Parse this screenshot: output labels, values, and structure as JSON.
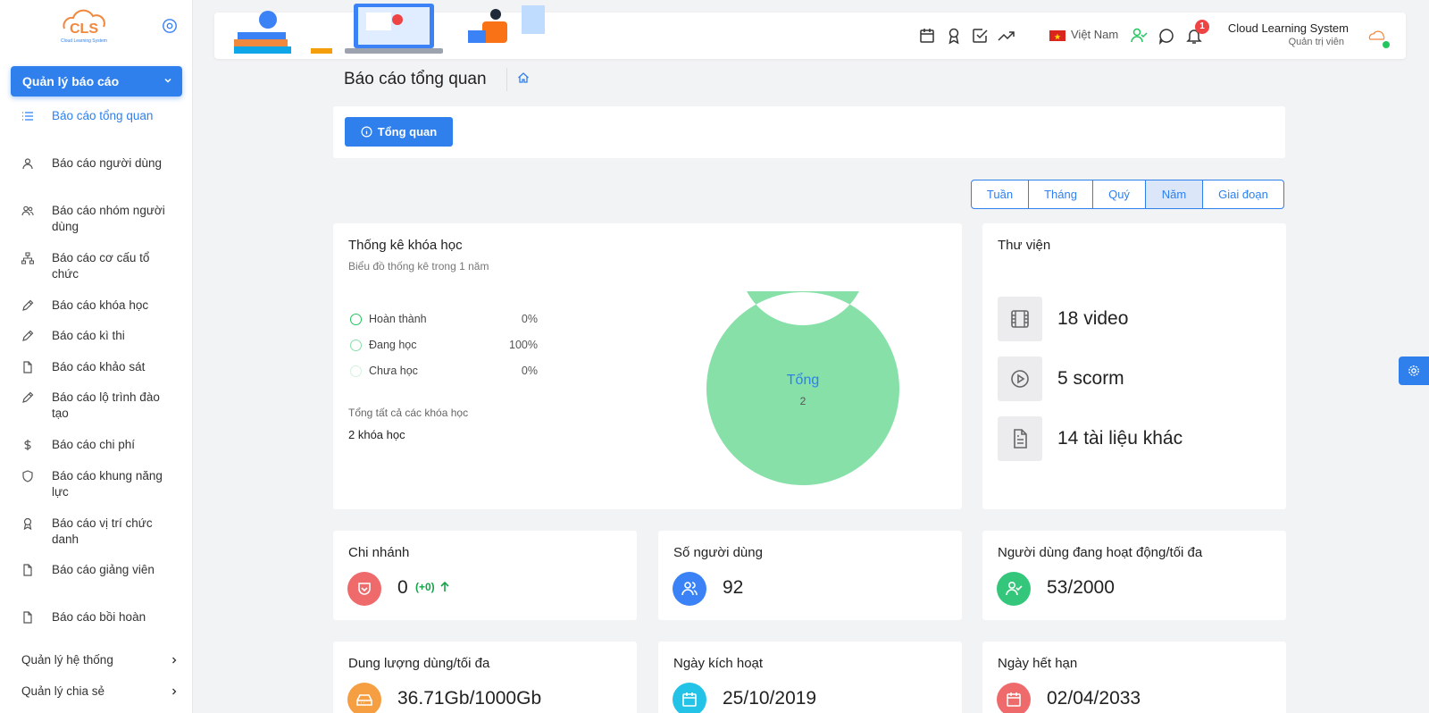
{
  "logo": {
    "text": "CLS",
    "caption": "Cloud Learning System"
  },
  "sidebar": {
    "active_group": "Quản lý báo cáo",
    "items": [
      {
        "label": "Báo cáo tổng quan",
        "icon": "list-icon"
      },
      {
        "label": "Báo cáo người dùng",
        "icon": "user-icon"
      },
      {
        "label": "Báo cáo nhóm người dùng",
        "icon": "users-icon"
      },
      {
        "label": "Báo cáo cơ cấu tổ chức",
        "icon": "sitemap-icon"
      },
      {
        "label": "Báo cáo khóa học",
        "icon": "pencil-icon"
      },
      {
        "label": "Báo cáo kì thi",
        "icon": "pencil-icon"
      },
      {
        "label": "Báo cáo khảo sát",
        "icon": "file-icon"
      },
      {
        "label": "Báo cáo lộ trình đào tạo",
        "icon": "pencil-icon"
      },
      {
        "label": "Báo cáo chi phí",
        "icon": "dollar-icon"
      },
      {
        "label": "Báo cáo khung năng lực",
        "icon": "shield-icon"
      },
      {
        "label": "Báo cáo vị trí chức danh",
        "icon": "award-icon"
      },
      {
        "label": "Báo cáo giảng viên",
        "icon": "file-icon"
      },
      {
        "label": "Báo cáo bồi hoàn",
        "icon": "file-icon"
      }
    ],
    "groups": [
      "Quản lý hệ thống",
      "Quản lý chia sẻ"
    ]
  },
  "header": {
    "language": "Việt Nam",
    "notification_count": "1",
    "system_name": "Cloud Learning System",
    "role": "Quản trị viên"
  },
  "page": {
    "title": "Báo cáo tổng quan",
    "tab": "Tổng quan",
    "periods": [
      "Tuần",
      "Tháng",
      "Quý",
      "Năm",
      "Giai đoạn"
    ],
    "active_period": "Năm"
  },
  "course_stats": {
    "title": "Thống kê khóa học",
    "subtitle": "Biểu đồ thống kê trong 1 năm",
    "legend": [
      {
        "label": "Hoàn thành",
        "pct": "0%",
        "color": "#22c55e"
      },
      {
        "label": "Đang học",
        "pct": "100%",
        "color": "#86e0a8"
      },
      {
        "label": "Chưa học",
        "pct": "0%",
        "color": "#d1f2dd"
      }
    ],
    "total_label": "Tổng tất cả các khóa học",
    "total_value": "2 khóa học",
    "center_label": "Tổng",
    "center_value": "2"
  },
  "chart_data": {
    "type": "pie",
    "categories": [
      "Hoàn thành",
      "Đang học",
      "Chưa học"
    ],
    "values": [
      0,
      100,
      0
    ],
    "title": "Thống kê khóa học"
  },
  "library": {
    "title": "Thư viện",
    "items": [
      {
        "text": "18 video",
        "icon": "film-icon"
      },
      {
        "text": "5 scorm",
        "icon": "play-circle-icon"
      },
      {
        "text": "14 tài liệu khác",
        "icon": "document-icon"
      }
    ]
  },
  "stats": {
    "branch": {
      "title": "Chi nhánh",
      "value": "0",
      "delta": "(+0)",
      "color": "#ef6a6a"
    },
    "users": {
      "title": "Số người dùng",
      "value": "92",
      "color": "#3b82f6"
    },
    "active_users": {
      "title": "Người dùng đang hoạt động/tối đa",
      "value": "53/2000",
      "color": "#34c77b"
    },
    "storage": {
      "title": "Dung lượng dùng/tối đa",
      "value": "36.71Gb/1000Gb",
      "color": "#f59e42"
    },
    "activation": {
      "title": "Ngày kích hoạt",
      "value": "25/10/2019",
      "color": "#22c3e6"
    },
    "expiry": {
      "title": "Ngày hết hạn",
      "value": "02/04/2033",
      "color": "#ef6a6a"
    }
  }
}
